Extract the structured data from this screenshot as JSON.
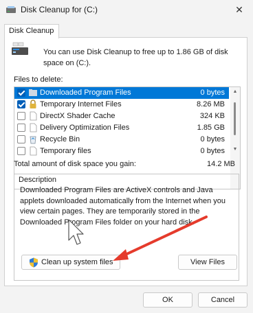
{
  "window": {
    "title": "Disk Cleanup for  (C:)"
  },
  "tab": {
    "label": "Disk Cleanup"
  },
  "intro": {
    "text": "You can use Disk Cleanup to free up to 1.86 GB of disk space on  (C:)."
  },
  "files": {
    "label": "Files to delete:",
    "items": [
      {
        "name": "Downloaded Program Files",
        "size": "0 bytes",
        "checked": true,
        "selected": true,
        "icon": "folder-icon"
      },
      {
        "name": "Temporary Internet Files",
        "size": "8.26 MB",
        "checked": true,
        "selected": false,
        "icon": "lock-icon"
      },
      {
        "name": "DirectX Shader Cache",
        "size": "324 KB",
        "checked": false,
        "selected": false,
        "icon": "file-icon"
      },
      {
        "name": "Delivery Optimization Files",
        "size": "1.85 GB",
        "checked": false,
        "selected": false,
        "icon": "file-icon"
      },
      {
        "name": "Recycle Bin",
        "size": "0 bytes",
        "checked": false,
        "selected": false,
        "icon": "recycle-bin-icon"
      },
      {
        "name": "Temporary files",
        "size": "0 bytes",
        "checked": false,
        "selected": false,
        "icon": "file-icon"
      }
    ]
  },
  "total": {
    "label": "Total amount of disk space you gain:",
    "value": "14.2 MB"
  },
  "description": {
    "title": "Description",
    "text": "Downloaded Program Files are ActiveX controls and Java applets downloaded automatically from the Internet when you view certain pages. They are temporarily stored in the Downloaded Program Files folder on your hard disk."
  },
  "buttons": {
    "cleanup_system": "Clean up system files",
    "view_files": "View Files",
    "ok": "OK",
    "cancel": "Cancel"
  },
  "colors": {
    "accent": "#0078d7",
    "annotation_arrow": "#e53b2c"
  }
}
